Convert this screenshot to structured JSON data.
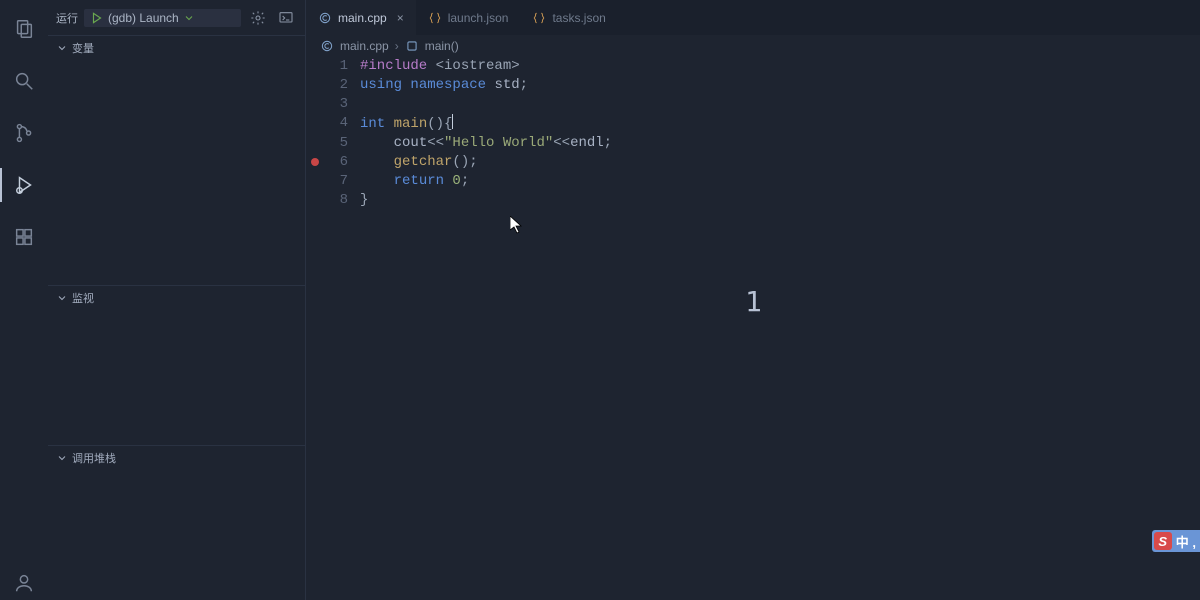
{
  "run_label": "运行",
  "launch_config": "(gdb) Launch",
  "sections": {
    "variables": "变量",
    "watch": "监视",
    "callstack": "调用堆栈"
  },
  "tabs": [
    {
      "label": "main.cpp",
      "icon": "cpp",
      "active": true
    },
    {
      "label": "launch.json",
      "icon": "json",
      "active": false
    },
    {
      "label": "tasks.json",
      "icon": "json",
      "active": false
    }
  ],
  "breadcrumbs": {
    "file": "main.cpp",
    "symbol": "main()"
  },
  "breakpoint_line": 6,
  "code": [
    {
      "n": 1,
      "tokens": [
        [
          "pre",
          "#include "
        ],
        [
          "pn",
          "<iostream>"
        ]
      ]
    },
    {
      "n": 2,
      "tokens": [
        [
          "kw",
          "using "
        ],
        [
          "kw",
          "namespace "
        ],
        [
          "id",
          "std"
        ],
        [
          "pn",
          ";"
        ]
      ]
    },
    {
      "n": 3,
      "tokens": []
    },
    {
      "n": 4,
      "tokens": [
        [
          "type",
          "int "
        ],
        [
          "fn",
          "main"
        ],
        [
          "pn",
          "(){"
        ]
      ],
      "cursor_after": true
    },
    {
      "n": 5,
      "tokens": [
        [
          "pn",
          "    "
        ],
        [
          "id",
          "cout"
        ],
        [
          "pn",
          "<<"
        ],
        [
          "str",
          "\"Hello World\""
        ],
        [
          "pn",
          "<<"
        ],
        [
          "id",
          "endl"
        ],
        [
          "pn",
          ";"
        ]
      ]
    },
    {
      "n": 6,
      "tokens": [
        [
          "pn",
          "    "
        ],
        [
          "fn",
          "getchar"
        ],
        [
          "pn",
          "();"
        ]
      ]
    },
    {
      "n": 7,
      "tokens": [
        [
          "pn",
          "    "
        ],
        [
          "kw",
          "return "
        ],
        [
          "num",
          "0"
        ],
        [
          "pn",
          ";"
        ]
      ]
    },
    {
      "n": 8,
      "tokens": [
        [
          "pn",
          "}"
        ]
      ]
    }
  ],
  "big_char": "1",
  "ime": {
    "s": "S",
    "text": "中 ,"
  }
}
